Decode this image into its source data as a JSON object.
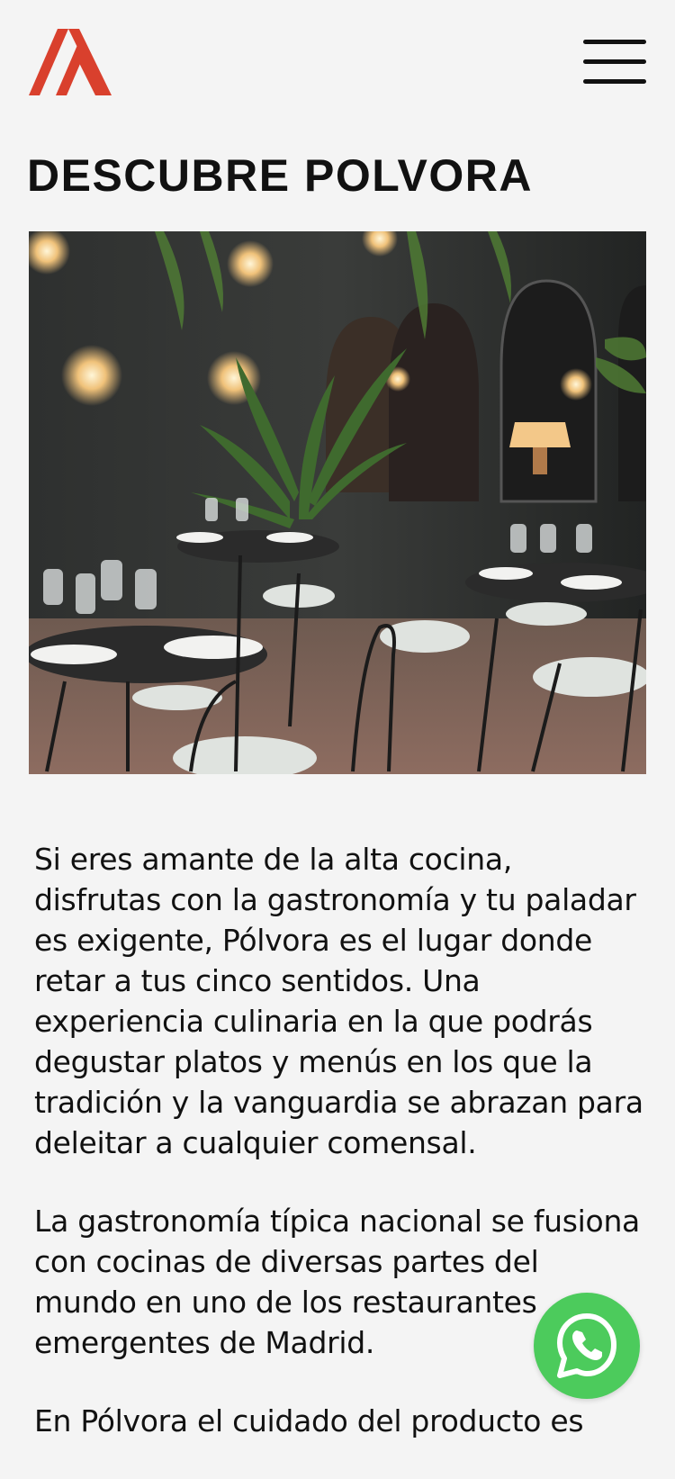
{
  "header": {
    "logo_icon": "polvora-logo-icon",
    "menu_icon": "hamburger-menu-icon"
  },
  "main": {
    "title": "DESCUBRE POLVORA",
    "hero_image": "restaurant-courtyard-photo",
    "paragraphs": [
      "Si eres amante de la alta cocina, disfrutas con la gastronomía y tu paladar es exigente, Pólvora es el lugar donde retar a tus cinco sentidos. Una experiencia culinaria en la que podrás degustar platos y menús en los que la tradición y la vanguardia se abrazan para deleitar a cualquier comensal.",
      "La gastronomía típica nacional se fusiona con cocinas de diversas partes del mundo en uno de los restaurantes emergentes de Madrid.",
      "En Pólvora el cuidado del producto es"
    ]
  },
  "floating": {
    "whatsapp_icon": "whatsapp-icon"
  },
  "colors": {
    "background": "#f4f4f4",
    "brand_red": "#d9402d",
    "whatsapp_green": "#4ccb5c",
    "text": "#111111"
  }
}
